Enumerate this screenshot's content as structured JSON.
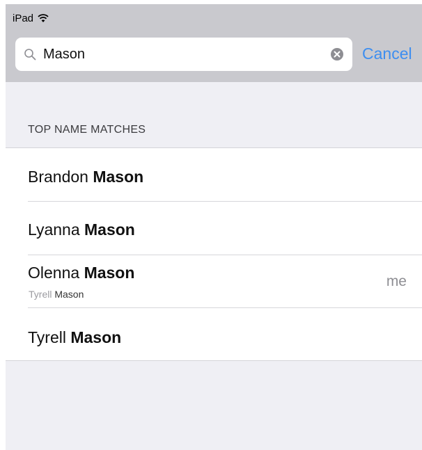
{
  "status_bar": {
    "device": "iPad",
    "wifi_icon": "wifi-icon"
  },
  "search": {
    "icon": "search-icon",
    "value": "Mason",
    "clear_icon": "clear-icon",
    "cancel_label": "Cancel"
  },
  "section": {
    "title": "TOP NAME MATCHES"
  },
  "results": [
    {
      "first": "Brandon",
      "last": "Mason",
      "sub_first": "",
      "sub_last": "",
      "accessory": ""
    },
    {
      "first": "Lyanna",
      "last": "Mason",
      "sub_first": "",
      "sub_last": "",
      "accessory": ""
    },
    {
      "first": "Olenna",
      "last": "Mason",
      "sub_first": "Tyrell",
      "sub_last": "Mason",
      "accessory": "me"
    },
    {
      "first": "Tyrell",
      "last": "Mason",
      "sub_first": "",
      "sub_last": "",
      "accessory": ""
    }
  ],
  "colors": {
    "accent": "#3d8ef0",
    "header_bg": "#c9c9ce",
    "background": "#efeff4"
  }
}
